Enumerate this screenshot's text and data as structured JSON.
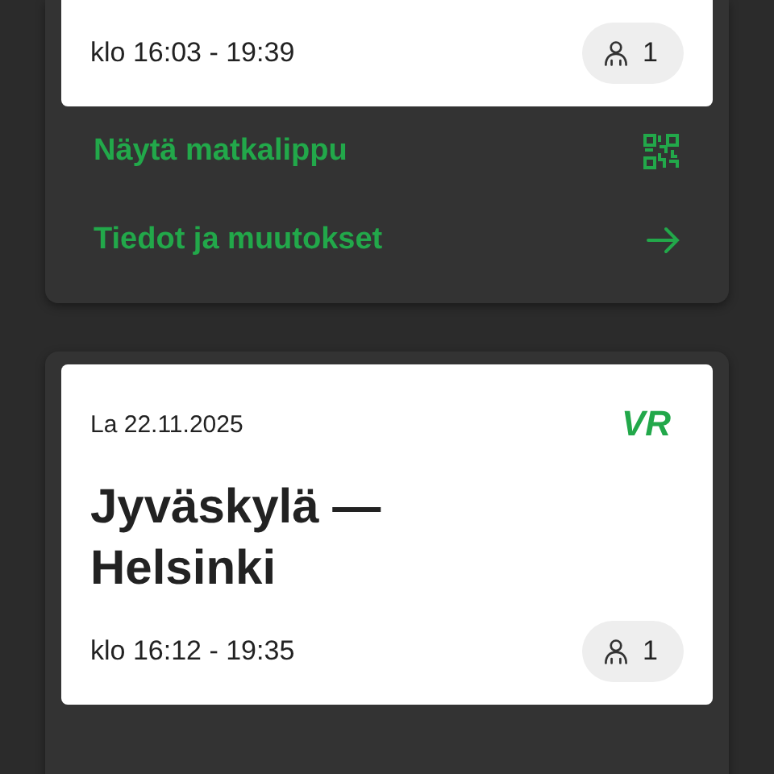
{
  "trips": [
    {
      "time": "klo 16:03 - 19:39",
      "passengers": "1",
      "actions": [
        {
          "kind": "ticket",
          "label": "Näytä matkalippu"
        },
        {
          "kind": "details",
          "label": "Tiedot ja muutokset"
        }
      ]
    },
    {
      "date": "La 22.11.2025",
      "route": "Jyväskylä —\nHelsinki",
      "time": "klo 16:12 - 19:35",
      "passengers": "1",
      "logo": "VR"
    }
  ]
}
